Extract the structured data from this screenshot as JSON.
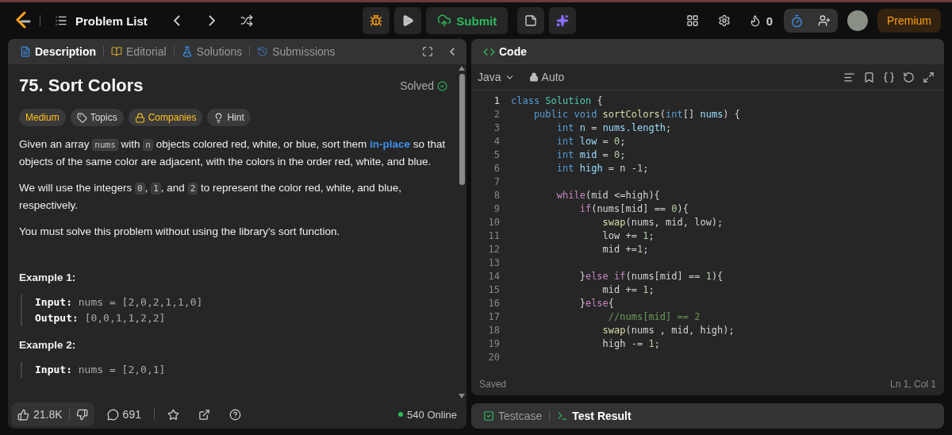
{
  "nav": {
    "title": "Problem List",
    "submit": "Submit",
    "streak": "0",
    "premium": "Premium"
  },
  "description": {
    "tabs": [
      {
        "label": "Description",
        "kind": "description",
        "selected": true
      },
      {
        "label": "Editorial",
        "kind": "editorial",
        "selected": false
      },
      {
        "label": "Solutions",
        "kind": "solutions",
        "selected": false
      },
      {
        "label": "Submissions",
        "kind": "submissions",
        "selected": false
      }
    ],
    "title": "75. Sort Colors",
    "status": "Solved",
    "tags": [
      {
        "label": "Medium",
        "kind": "difficulty"
      },
      {
        "label": "Topics",
        "kind": "topics"
      },
      {
        "label": "Companies",
        "kind": "companies"
      },
      {
        "label": "Hint",
        "kind": "hint"
      }
    ],
    "paragraphs": [
      [
        {
          "kind": "text",
          "text": "Given an array "
        },
        {
          "kind": "code",
          "text": "nums"
        },
        {
          "kind": "text",
          "text": " with "
        },
        {
          "kind": "code",
          "text": "n"
        },
        {
          "kind": "text",
          "text": " objects colored red, white, or blue, sort them "
        },
        {
          "kind": "link",
          "text": "in-place"
        },
        {
          "kind": "text",
          "text": " so that objects of the same color are adjacent, with the colors in the order red, white, and blue."
        }
      ],
      [
        {
          "kind": "text",
          "text": "We will use the integers "
        },
        {
          "kind": "code",
          "text": "0"
        },
        {
          "kind": "text",
          "text": ", "
        },
        {
          "kind": "code",
          "text": "1"
        },
        {
          "kind": "text",
          "text": ", and "
        },
        {
          "kind": "code",
          "text": "2"
        },
        {
          "kind": "text",
          "text": " to represent the color red, white, and blue, respectively."
        }
      ],
      [
        {
          "kind": "text",
          "text": "You must solve this problem without using the library's sort function."
        }
      ]
    ],
    "examples": [
      {
        "title": "Example 1:",
        "lines": [
          {
            "label": "Input:",
            "value": "nums = [2,0,2,1,1,0]"
          },
          {
            "label": "Output:",
            "value": "[0,0,1,1,2,2]"
          }
        ]
      },
      {
        "title": "Example 2:",
        "lines": [
          {
            "label": "Input:",
            "value": "nums = [2,0,1]"
          }
        ]
      }
    ],
    "footer": {
      "likes": "21.8K",
      "comments": "691",
      "online": "540 Online"
    }
  },
  "editor": {
    "tab": "Code",
    "language": "Java",
    "mode": "Auto",
    "lines": [
      {
        "number": "1",
        "tokens": [
          {
            "kind": "kw",
            "text": "class "
          },
          {
            "kind": "cls",
            "text": "Solution"
          },
          {
            "kind": "txt",
            "text": " {"
          }
        ]
      },
      {
        "number": "2",
        "tokens": [
          {
            "kind": "kw",
            "text": "    public void "
          },
          {
            "kind": "fn",
            "text": "sortColors"
          },
          {
            "kind": "txt",
            "text": "("
          },
          {
            "kind": "kw",
            "text": "int"
          },
          {
            "kind": "txt",
            "text": "[] "
          },
          {
            "kind": "var",
            "text": "nums"
          },
          {
            "kind": "txt",
            "text": ") {"
          }
        ]
      },
      {
        "number": "3",
        "tokens": [
          {
            "kind": "kw",
            "text": "        int "
          },
          {
            "kind": "var",
            "text": "n"
          },
          {
            "kind": "txt",
            "text": " = "
          },
          {
            "kind": "var",
            "text": "nums.length"
          },
          {
            "kind": "txt",
            "text": ";"
          }
        ]
      },
      {
        "number": "4",
        "tokens": [
          {
            "kind": "kw",
            "text": "        int "
          },
          {
            "kind": "var",
            "text": "low"
          },
          {
            "kind": "txt",
            "text": " = "
          },
          {
            "kind": "num",
            "text": "0"
          },
          {
            "kind": "txt",
            "text": ";"
          }
        ]
      },
      {
        "number": "5",
        "tokens": [
          {
            "kind": "kw",
            "text": "        int "
          },
          {
            "kind": "var",
            "text": "mid"
          },
          {
            "kind": "txt",
            "text": " = "
          },
          {
            "kind": "num",
            "text": "0"
          },
          {
            "kind": "txt",
            "text": ";"
          }
        ]
      },
      {
        "number": "6",
        "tokens": [
          {
            "kind": "kw",
            "text": "        int "
          },
          {
            "kind": "var",
            "text": "high"
          },
          {
            "kind": "txt",
            "text": " = n -"
          },
          {
            "kind": "num",
            "text": "1"
          },
          {
            "kind": "txt",
            "text": ";"
          }
        ]
      },
      {
        "number": "7"
      },
      {
        "number": "8",
        "tokens": [
          {
            "kind": "ctl",
            "text": "        while"
          },
          {
            "kind": "txt",
            "text": "(mid <=high){"
          }
        ]
      },
      {
        "number": "9",
        "tokens": [
          {
            "kind": "ctl",
            "text": "            if"
          },
          {
            "kind": "txt",
            "text": "(nums[mid] == "
          },
          {
            "kind": "num",
            "text": "0"
          },
          {
            "kind": "txt",
            "text": "){"
          }
        ]
      },
      {
        "number": "10",
        "tokens": [
          {
            "kind": "fn",
            "text": "                swap"
          },
          {
            "kind": "txt",
            "text": "(nums, mid, low);"
          }
        ]
      },
      {
        "number": "11",
        "tokens": [
          {
            "kind": "txt",
            "text": "                low += "
          },
          {
            "kind": "num",
            "text": "1"
          },
          {
            "kind": "txt",
            "text": ";"
          }
        ]
      },
      {
        "number": "12",
        "tokens": [
          {
            "kind": "txt",
            "text": "                mid +="
          },
          {
            "kind": "num",
            "text": "1"
          },
          {
            "kind": "txt",
            "text": ";"
          }
        ]
      },
      {
        "number": "13"
      },
      {
        "number": "14",
        "tokens": [
          {
            "kind": "txt",
            "text": "            }"
          },
          {
            "kind": "ctl",
            "text": "else if"
          },
          {
            "kind": "txt",
            "text": "(nums[mid] == "
          },
          {
            "kind": "num",
            "text": "1"
          },
          {
            "kind": "txt",
            "text": "){"
          }
        ]
      },
      {
        "number": "15",
        "tokens": [
          {
            "kind": "txt",
            "text": "                mid += "
          },
          {
            "kind": "num",
            "text": "1"
          },
          {
            "kind": "txt",
            "text": ";"
          }
        ]
      },
      {
        "number": "16",
        "tokens": [
          {
            "kind": "txt",
            "text": "            }"
          },
          {
            "kind": "ctl",
            "text": "else"
          },
          {
            "kind": "txt",
            "text": "{"
          }
        ]
      },
      {
        "number": "17",
        "tokens": [
          {
            "kind": "cmt",
            "text": "                 //nums[mid] == 2"
          }
        ]
      },
      {
        "number": "18",
        "tokens": [
          {
            "kind": "fn",
            "text": "                swap"
          },
          {
            "kind": "txt",
            "text": "(nums , mid, high);"
          }
        ]
      },
      {
        "number": "19",
        "tokens": [
          {
            "kind": "txt",
            "text": "                high -= "
          },
          {
            "kind": "num",
            "text": "1"
          },
          {
            "kind": "txt",
            "text": ";"
          }
        ]
      },
      {
        "number": "20"
      }
    ],
    "saved": "Saved",
    "cursor": "Ln 1, Col 1"
  },
  "bottom_tabs": [
    {
      "label": "Testcase",
      "kind": "testcase",
      "selected": false
    },
    {
      "label": "Test Result",
      "kind": "result",
      "selected": true
    }
  ]
}
